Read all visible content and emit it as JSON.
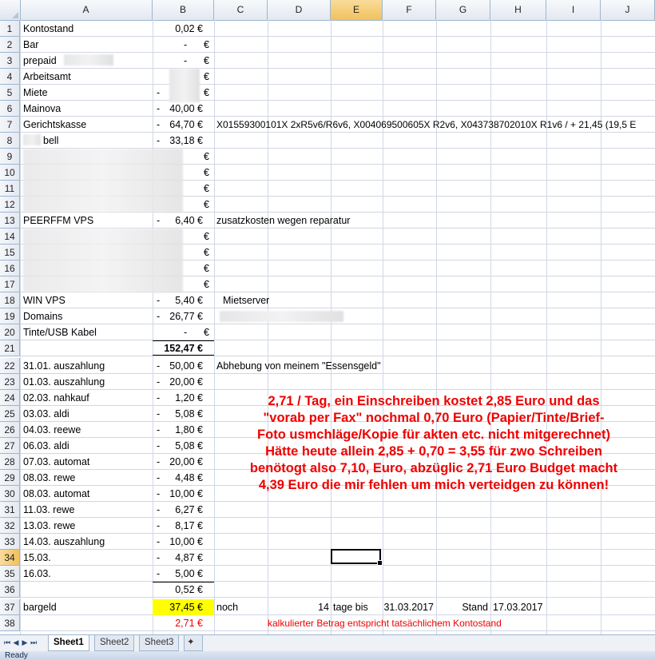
{
  "columns": [
    "A",
    "B",
    "C",
    "D",
    "E",
    "F",
    "G",
    "H",
    "I",
    "J"
  ],
  "rows": [
    "1",
    "2",
    "3",
    "4",
    "5",
    "6",
    "7",
    "8",
    "9",
    "10",
    "11",
    "12",
    "13",
    "14",
    "15",
    "16",
    "17",
    "18",
    "19",
    "20",
    "21",
    "22",
    "23",
    "24",
    "25",
    "26",
    "27",
    "28",
    "29",
    "30",
    "31",
    "32",
    "33",
    "34",
    "35",
    "36",
    "37",
    "38"
  ],
  "cells": {
    "a1": "Kontostand",
    "b1": "0,02 €",
    "a2": "Bar",
    "b2": "-",
    "e2": "€",
    "a3": "prepaid",
    "b3": "-",
    "e3": "€",
    "a4": "Arbeitsamt",
    "e4": "€",
    "a5": "Miete",
    "d5": "-",
    "e5": "€",
    "a6": "Mainova",
    "d6": "-",
    "b6": "40,00 €",
    "a7": "Gerichtskasse",
    "d7": "-",
    "b7": "64,70 €",
    "c7": "X01559300101X 2xR5v6/R6v6, X004069500605X R2v6, X043738702010X R1v6 / + 21,45 (19,5 E",
    "a8": "bell",
    "d8": "-",
    "b8": "33,18 €",
    "e9": "€",
    "e10": "€",
    "e11": "€",
    "e12": "€",
    "a13": "PEERFFM VPS",
    "d13": "-",
    "b13": "6,40 €",
    "c13": "zusatzkosten wegen reparatur",
    "e14": "€",
    "e15": "€",
    "e16": "€",
    "e17": "€",
    "a18": "WIN VPS",
    "d18": "-",
    "b18": "5,40 €",
    "c18": "Mietserver",
    "a19": "Domains",
    "d19": "-",
    "b19": "26,77 €",
    "a20": "Tinte/USB Kabel",
    "b20": "-",
    "e20": "€",
    "b21": "152,47 €",
    "a22": "31.01. auszahlung",
    "d22": "-",
    "b22": "50,00 €",
    "c22": "Abhebung von meinem \"Essensgeld\"",
    "a23": "01.03. auszahlung",
    "d23": "-",
    "b23": "20,00 €",
    "a24": "02.03. nahkauf",
    "d24": "-",
    "b24": "1,20 €",
    "a25": "03.03. aldi",
    "d25": "-",
    "b25": "5,08 €",
    "a26": "04.03. reewe",
    "d26": "-",
    "b26": "1,80 €",
    "a27": "06.03. aldi",
    "d27": "-",
    "b27": "5,08 €",
    "a28": "07.03. automat",
    "d28": "-",
    "b28": "20,00 €",
    "a29": "08.03. rewe",
    "d29": "-",
    "b29": "4,48 €",
    "a30": "08.03. automat",
    "d30": "-",
    "b30": "10,00 €",
    "a31": "11.03. rewe",
    "d31": "-",
    "b31": "6,27 €",
    "a32": "13.03. rewe",
    "d32": "-",
    "b32": "8,17 €",
    "a33": "14.03. auszahlung",
    "d33": "-",
    "b33": "10,00 €",
    "a34": "15.03.",
    "d34": "-",
    "b34": "4,87 €",
    "a35": "16.03.",
    "d35": "-",
    "b35": "5,00 €",
    "b36": "0,52 €",
    "a37": "bargeld",
    "b37": "37,45 €",
    "c37": "noch",
    "d37": "14",
    "e37": "tage bis",
    "f37": "31.03.2017",
    "g37": "Stand",
    "h37": "17.03.2017",
    "b38": "2,71 €",
    "c38": "kalkulierter Betrag entspricht tatsächlichem Kontostand"
  },
  "annotation": [
    "2,71 / Tag, ein Einschreiben kostet 2,85 Euro und das",
    "\"vorab per Fax\" nochmal 0,70 Euro (Papier/Tinte/Brief-",
    "Foto usmchläge/Kopie für akten etc. nicht mitgerechnet)",
    "Hätte heute allein 2,85 + 0,70 = 3,55 für zwo Schreiben",
    "benötogt also 7,10, Euro, abzüglic 2,71 Euro Budget macht",
    "4,39 Euro die mir fehlen um mich verteidgen zu können!"
  ],
  "tabs": [
    "Sheet1",
    "Sheet2",
    "Sheet3"
  ],
  "status": "Ready",
  "colors": {
    "annotation": "#ee0000",
    "highlight": "#ffff00",
    "selected_header": "#f6cc6e"
  }
}
